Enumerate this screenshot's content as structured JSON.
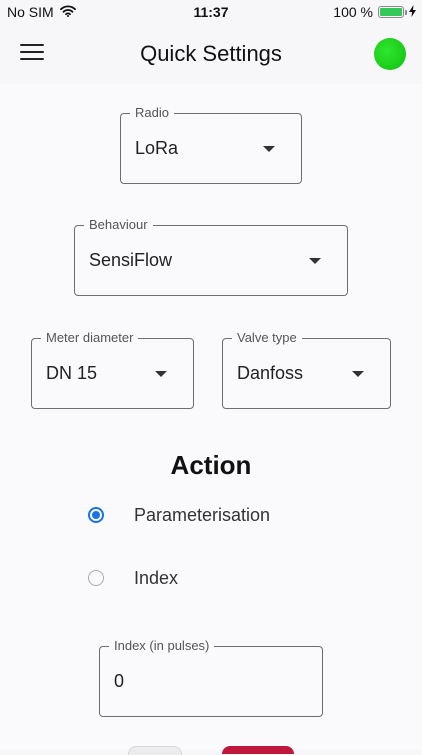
{
  "status_bar": {
    "carrier": "No SIM",
    "time": "11:37",
    "battery": "100 %",
    "battery_level": 1.0
  },
  "app_bar": {
    "title": "Quick Settings",
    "connection_color": "#19d019"
  },
  "form": {
    "radio": {
      "label": "Radio",
      "value": "LoRa"
    },
    "behaviour": {
      "label": "Behaviour",
      "value": "SensiFlow"
    },
    "meter_diameter": {
      "label": "Meter diameter",
      "value": "DN 15"
    },
    "valve_type": {
      "label": "Valve type",
      "value": "Danfoss"
    }
  },
  "action": {
    "title": "Action",
    "options": [
      {
        "label": "Parameterisation",
        "selected": true
      },
      {
        "label": "Index",
        "selected": false
      }
    ]
  },
  "index_field": {
    "label": "Index (in pulses)",
    "value": "0"
  },
  "colors": {
    "accent": "#1a73e8",
    "danger": "#c0183c"
  }
}
